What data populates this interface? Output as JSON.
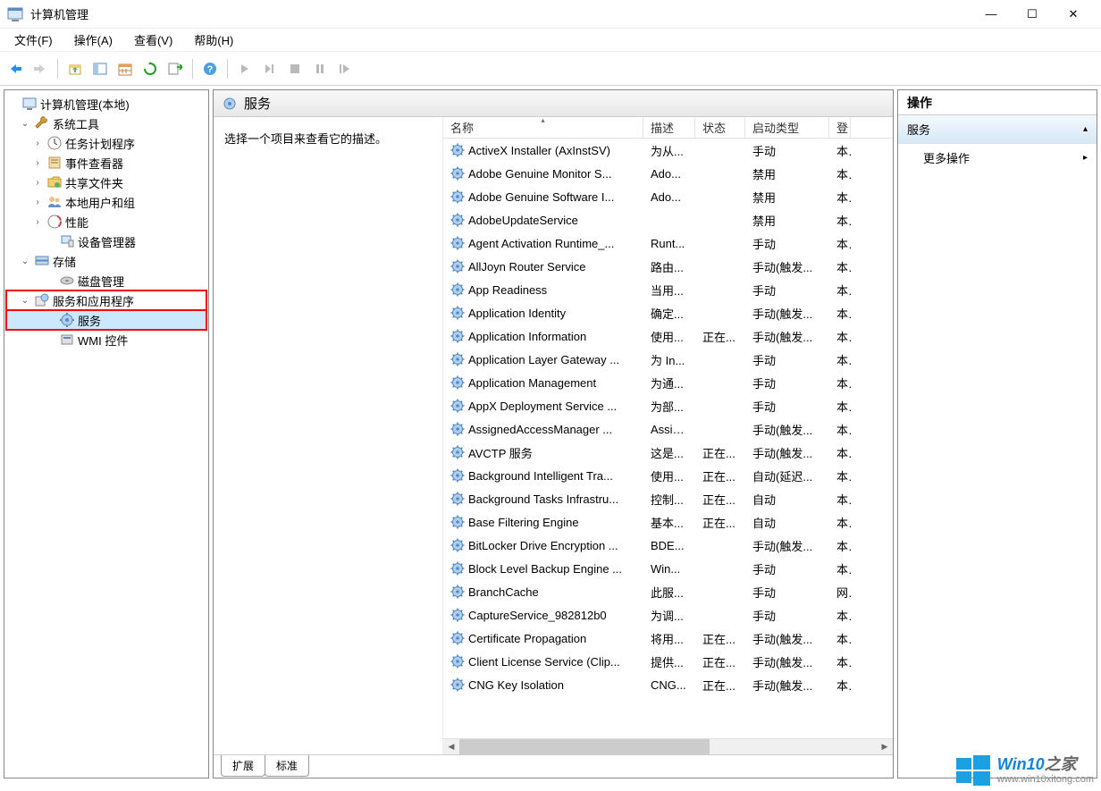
{
  "window": {
    "title": "计算机管理",
    "controls": {
      "min": "—",
      "max": "☐",
      "close": "✕"
    }
  },
  "menu": {
    "file": "文件(F)",
    "action": "操作(A)",
    "view": "查看(V)",
    "help": "帮助(H)"
  },
  "tree": {
    "root": "计算机管理(本地)",
    "system_tools": "系统工具",
    "task_scheduler": "任务计划程序",
    "event_viewer": "事件查看器",
    "shared_folders": "共享文件夹",
    "local_users": "本地用户和组",
    "performance": "性能",
    "device_manager": "设备管理器",
    "storage": "存储",
    "disk_management": "磁盘管理",
    "services_apps": "服务和应用程序",
    "services": "服务",
    "wmi": "WMI 控件"
  },
  "center": {
    "header": "服务",
    "select_prompt": "选择一个项目来查看它的描述。",
    "columns": {
      "name": "名称",
      "desc": "描述",
      "state": "状态",
      "start": "启动类型",
      "logon": "登"
    },
    "services": [
      {
        "name": "ActiveX Installer (AxInstSV)",
        "desc": "为从...",
        "state": "",
        "start": "手动",
        "logon": "本"
      },
      {
        "name": "Adobe Genuine Monitor S...",
        "desc": "Ado...",
        "state": "",
        "start": "禁用",
        "logon": "本"
      },
      {
        "name": "Adobe Genuine Software I...",
        "desc": "Ado...",
        "state": "",
        "start": "禁用",
        "logon": "本"
      },
      {
        "name": "AdobeUpdateService",
        "desc": "",
        "state": "",
        "start": "禁用",
        "logon": "本"
      },
      {
        "name": "Agent Activation Runtime_...",
        "desc": "Runt...",
        "state": "",
        "start": "手动",
        "logon": "本"
      },
      {
        "name": "AllJoyn Router Service",
        "desc": "路由...",
        "state": "",
        "start": "手动(触发...",
        "logon": "本"
      },
      {
        "name": "App Readiness",
        "desc": "当用...",
        "state": "",
        "start": "手动",
        "logon": "本"
      },
      {
        "name": "Application Identity",
        "desc": "确定...",
        "state": "",
        "start": "手动(触发...",
        "logon": "本"
      },
      {
        "name": "Application Information",
        "desc": "使用...",
        "state": "正在...",
        "start": "手动(触发...",
        "logon": "本"
      },
      {
        "name": "Application Layer Gateway ...",
        "desc": "为 In...",
        "state": "",
        "start": "手动",
        "logon": "本"
      },
      {
        "name": "Application Management",
        "desc": "为通...",
        "state": "",
        "start": "手动",
        "logon": "本"
      },
      {
        "name": "AppX Deployment Service ...",
        "desc": "为部...",
        "state": "",
        "start": "手动",
        "logon": "本"
      },
      {
        "name": "AssignedAccessManager ...",
        "desc": "Assig...",
        "state": "",
        "start": "手动(触发...",
        "logon": "本"
      },
      {
        "name": "AVCTP 服务",
        "desc": "这是...",
        "state": "正在...",
        "start": "手动(触发...",
        "logon": "本"
      },
      {
        "name": "Background Intelligent Tra...",
        "desc": "使用...",
        "state": "正在...",
        "start": "自动(延迟...",
        "logon": "本"
      },
      {
        "name": "Background Tasks Infrastru...",
        "desc": "控制...",
        "state": "正在...",
        "start": "自动",
        "logon": "本"
      },
      {
        "name": "Base Filtering Engine",
        "desc": "基本...",
        "state": "正在...",
        "start": "自动",
        "logon": "本"
      },
      {
        "name": "BitLocker Drive Encryption ...",
        "desc": "BDE...",
        "state": "",
        "start": "手动(触发...",
        "logon": "本"
      },
      {
        "name": "Block Level Backup Engine ...",
        "desc": "Win...",
        "state": "",
        "start": "手动",
        "logon": "本"
      },
      {
        "name": "BranchCache",
        "desc": "此服...",
        "state": "",
        "start": "手动",
        "logon": "网"
      },
      {
        "name": "CaptureService_982812b0",
        "desc": "为调...",
        "state": "",
        "start": "手动",
        "logon": "本"
      },
      {
        "name": "Certificate Propagation",
        "desc": "将用...",
        "state": "正在...",
        "start": "手动(触发...",
        "logon": "本"
      },
      {
        "name": "Client License Service (Clip...",
        "desc": "提供...",
        "state": "正在...",
        "start": "手动(触发...",
        "logon": "本"
      },
      {
        "name": "CNG Key Isolation",
        "desc": "CNG...",
        "state": "正在...",
        "start": "手动(触发...",
        "logon": "本"
      }
    ],
    "tabs": {
      "extended": "扩展",
      "standard": "标准"
    }
  },
  "actions": {
    "header": "操作",
    "section": "服务",
    "more": "更多操作"
  },
  "watermark": {
    "brand": "Win10",
    "suffix": "之家",
    "url": "www.win10xitong.com"
  }
}
